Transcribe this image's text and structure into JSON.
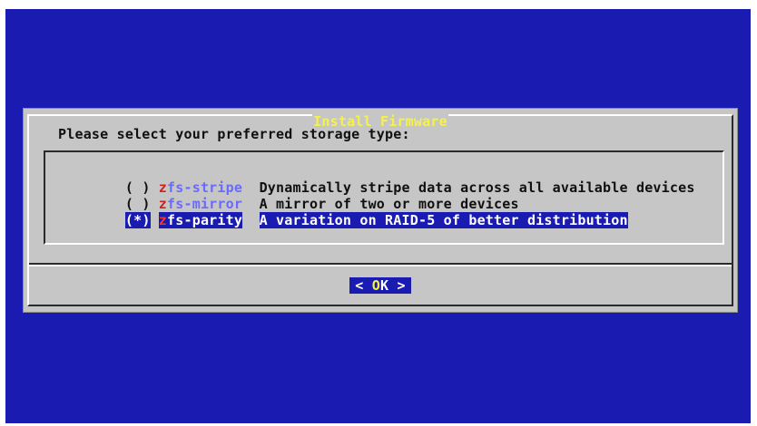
{
  "dialog": {
    "title": "Install Firmware",
    "prompt": "Please select your preferred storage type:",
    "options": [
      {
        "mark": "( )",
        "hotkey": "z",
        "tag_rest": "fs-stripe",
        "description": "Dynamically stripe data across all available devices",
        "selected": false
      },
      {
        "mark": "( )",
        "hotkey": "z",
        "tag_rest": "fs-mirror",
        "description": "A mirror of two or more devices",
        "selected": false
      },
      {
        "mark": "(*)",
        "hotkey": "z",
        "tag_rest": "fs-parity",
        "description": "A variation on RAID-5 of better distribution",
        "selected": true
      }
    ],
    "buttons": {
      "ok": {
        "left": "<",
        "pre": " ",
        "hotkey": "O",
        "rest": "K",
        "right": " >"
      }
    }
  },
  "colors": {
    "background": "#1a1bb0",
    "dialog": "#c6c6c6",
    "title_text": "#f6f24a",
    "hotkey": "#d21f1f",
    "tag": "#6a6aff",
    "selection": "#1a1bb0"
  }
}
